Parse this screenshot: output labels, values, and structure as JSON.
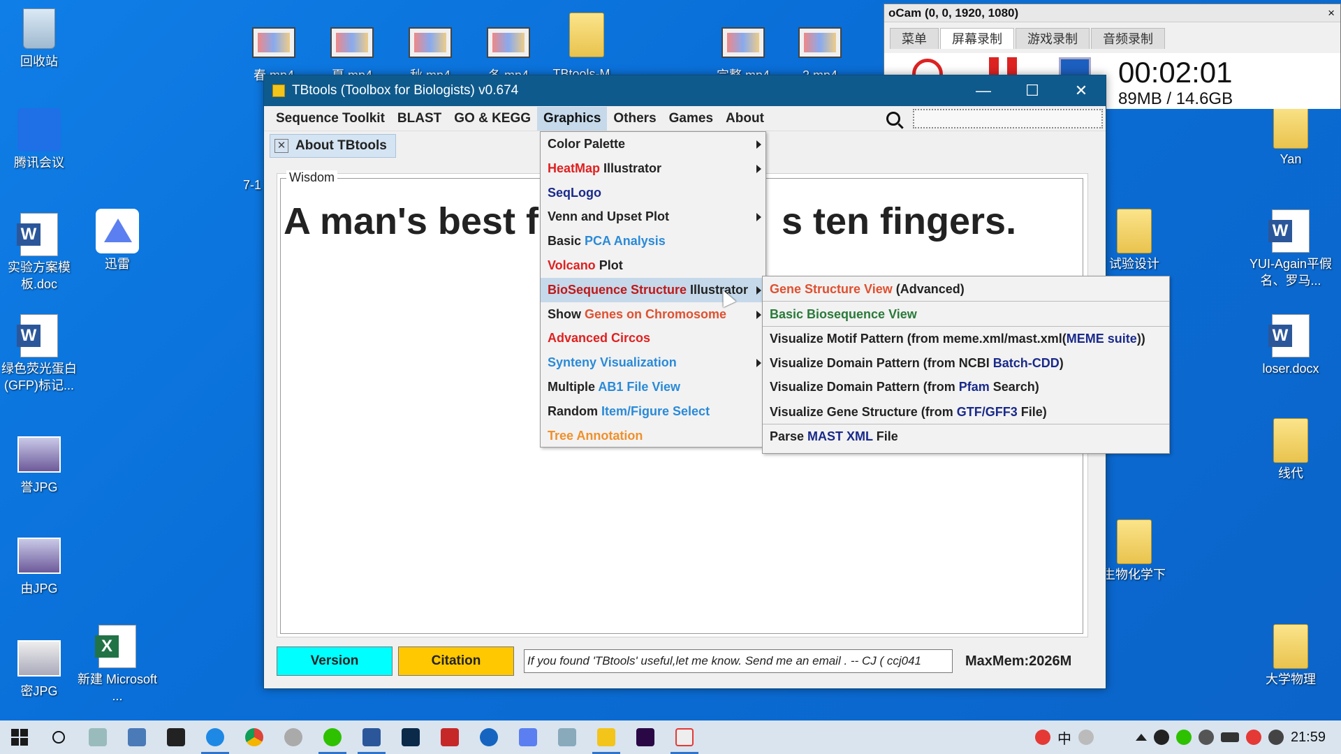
{
  "desktop": {
    "icons": [
      {
        "label": "回收站"
      },
      {
        "label": "腾讯会议"
      },
      {
        "label": "实验方案模板.doc"
      },
      {
        "label": "迅雷"
      },
      {
        "label": "绿色荧光蛋白(GFP)标记..."
      },
      {
        "label": "誉JPG"
      },
      {
        "label": "由JPG"
      },
      {
        "label": "密JPG"
      },
      {
        "label": "新建 Microsoft ..."
      },
      {
        "label": "春.mp4"
      },
      {
        "label": "夏.mp4"
      },
      {
        "label": "秋.mp4"
      },
      {
        "label": "冬.mp4"
      },
      {
        "label": "TBtools-M..."
      },
      {
        "label": "完整.mp4"
      },
      {
        "label": "2.mp4"
      },
      {
        "label": "Yan"
      },
      {
        "label": "试验设计"
      },
      {
        "label": "YUI-Again平假名、罗马..."
      },
      {
        "label": "loser.docx"
      },
      {
        "label": "线代"
      },
      {
        "label": "生物化学下"
      },
      {
        "label": "大学物理"
      },
      {
        "label": "7-1"
      }
    ]
  },
  "ocam": {
    "title": "oCam (0, 0, 1920, 1080)",
    "close": "×",
    "tabs": [
      "菜单",
      "屏幕录制",
      "游戏录制",
      "音频录制"
    ],
    "timer": "00:02:01",
    "size": "89MB / 14.6GB"
  },
  "tbwin": {
    "title": "TBtools (Toolbox for Biologists) v0.674",
    "minimize": "—",
    "maximize": "☐",
    "close": "✕",
    "menus": [
      "Sequence Toolkit",
      "BLAST",
      "GO & KEGG",
      "Graphics",
      "Others",
      "Games",
      "About"
    ],
    "tab_label": "About TBtools",
    "tab_close": "✕",
    "wisdom_legend": "Wisdom",
    "wisdom_left": "A man's best f",
    "wisdom_right": "s ten fingers.",
    "version_btn": "Version",
    "citation_btn": "Citation",
    "message": "If you found 'TBtools' useful,let me know. Send me an email . -- CJ   ( ccj041",
    "maxmem": "MaxMem:2026M"
  },
  "graphics_menu": [
    {
      "parts": [
        {
          "t": "Color Palette",
          "c": "#222222"
        }
      ],
      "arrow": true
    },
    {
      "parts": [
        {
          "t": "HeatMap",
          "c": "#e02020"
        },
        {
          "t": " Illustrator",
          "c": "#222222"
        }
      ],
      "arrow": true
    },
    {
      "parts": [
        {
          "t": "SeqLogo",
          "c": "#1a2a8a"
        }
      ],
      "arrow": false
    },
    {
      "parts": [
        {
          "t": "Venn and Upset Plot",
          "c": "#222222"
        }
      ],
      "arrow": true
    },
    {
      "parts": [
        {
          "t": "Basic ",
          "c": "#222222"
        },
        {
          "t": "PCA Analysis",
          "c": "#2a8ad8"
        }
      ],
      "arrow": false
    },
    {
      "parts": [
        {
          "t": "Volcano",
          "c": "#e02020"
        },
        {
          "t": " Plot",
          "c": "#222222"
        }
      ],
      "arrow": false
    },
    {
      "parts": [
        {
          "t": "BioSequence Structure",
          "c": "#c01818"
        },
        {
          "t": " Illustrator",
          "c": "#222222"
        }
      ],
      "arrow": true
    },
    {
      "parts": [
        {
          "t": "Show ",
          "c": "#222222"
        },
        {
          "t": "Genes on Chromosome",
          "c": "#e05030"
        }
      ],
      "arrow": true
    },
    {
      "parts": [
        {
          "t": "Advanced Circos",
          "c": "#e02020"
        }
      ],
      "arrow": false
    },
    {
      "parts": [
        {
          "t": "Synteny Visualization",
          "c": "#2a8ad8"
        }
      ],
      "arrow": true
    },
    {
      "parts": [
        {
          "t": "Multiple ",
          "c": "#222222"
        },
        {
          "t": "AB1 File View",
          "c": "#2a8ad8"
        }
      ],
      "arrow": false
    },
    {
      "parts": [
        {
          "t": "Random ",
          "c": "#222222"
        },
        {
          "t": "Item/Figure Select",
          "c": "#2a8ad8"
        }
      ],
      "arrow": false
    },
    {
      "parts": [
        {
          "t": "Tree Annotation",
          "c": "#f0902a"
        }
      ],
      "arrow": false
    }
  ],
  "submenu": [
    {
      "parts": [
        {
          "t": "Gene Structure View",
          "c": "#e05030"
        },
        {
          "t": " (Advanced)",
          "c": "#222222"
        }
      ],
      "sep": true
    },
    {
      "parts": [
        {
          "t": "Basic Biosequence View",
          "c": "#2a7a3a"
        }
      ],
      "sep": true
    },
    {
      "parts": [
        {
          "t": "Visualize Motif Pattern (from meme.xml/mast.xml(",
          "c": "#222222"
        },
        {
          "t": "MEME suite",
          "c": "#1a2a8a"
        },
        {
          "t": "))",
          "c": "#222222"
        }
      ],
      "sep": false
    },
    {
      "parts": [
        {
          "t": "Visualize Domain Pattern (from NCBI ",
          "c": "#222222"
        },
        {
          "t": "Batch-CDD",
          "c": "#1a2a8a"
        },
        {
          "t": ")",
          "c": "#222222"
        }
      ],
      "sep": false
    },
    {
      "parts": [
        {
          "t": "Visualize Domain Pattern (from ",
          "c": "#222222"
        },
        {
          "t": "Pfam",
          "c": "#1a2a8a"
        },
        {
          "t": " Search)",
          "c": "#222222"
        }
      ],
      "sep": false
    },
    {
      "parts": [
        {
          "t": "Visualize Gene Structure (from ",
          "c": "#222222"
        },
        {
          "t": "GTF/GFF3",
          "c": "#1a2a8a"
        },
        {
          "t": " File)",
          "c": "#222222"
        }
      ],
      "sep": true
    },
    {
      "parts": [
        {
          "t": "Parse ",
          "c": "#222222"
        },
        {
          "t": "MAST XML",
          "c": "#1a2a8a"
        },
        {
          "t": " File",
          "c": "#222222"
        }
      ],
      "sep": false
    }
  ],
  "taskbar": {
    "clock": "21:59",
    "ime": "中"
  }
}
